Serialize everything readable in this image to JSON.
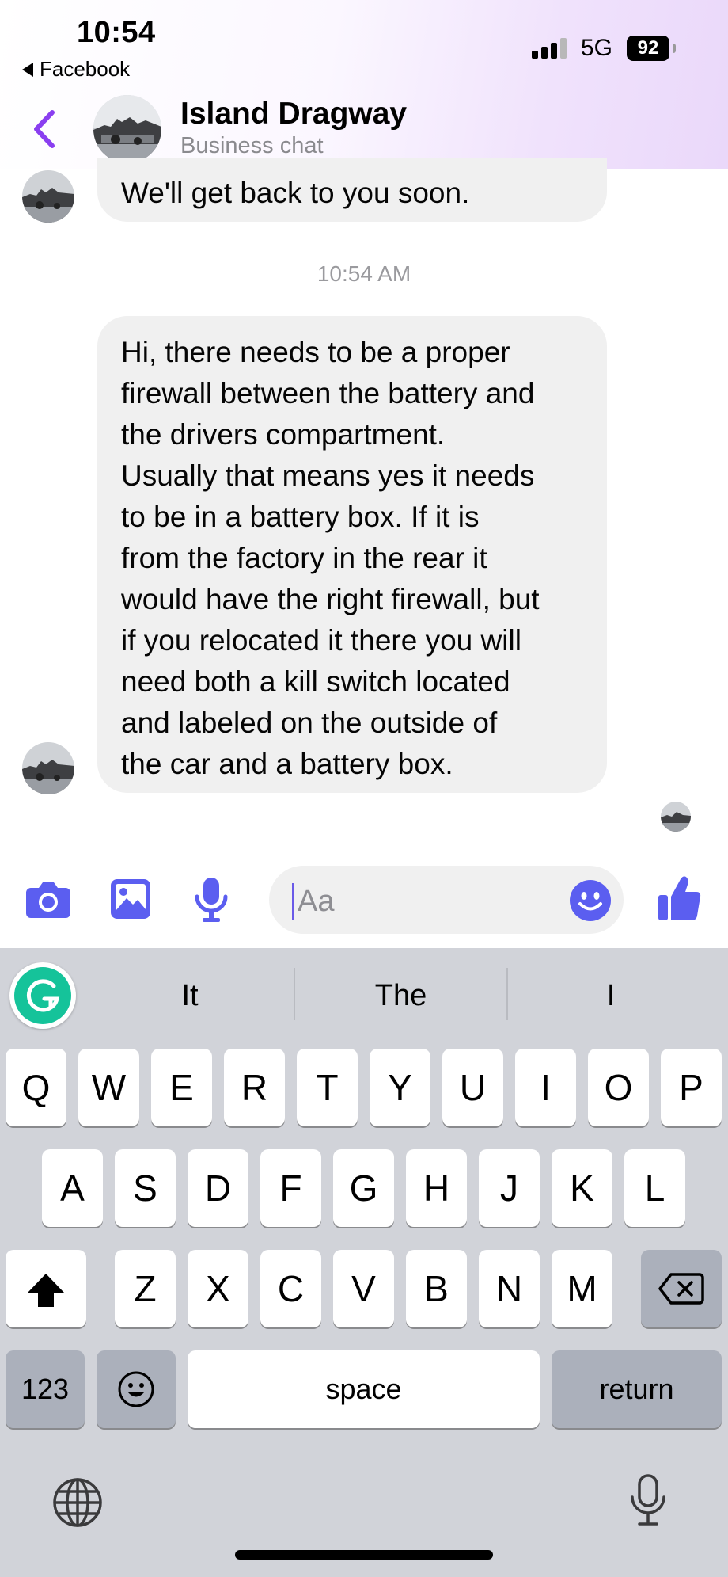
{
  "status_bar": {
    "time": "10:54",
    "back_app": "Facebook",
    "network": "5G",
    "battery": "92"
  },
  "header": {
    "contact_name": "Island Dragway",
    "contact_subtitle": "Business chat"
  },
  "messages": {
    "first_text": "We'll get back to you soon.",
    "timestamp": "10:54 AM",
    "second_lines": [
      "Hi, there needs to be a proper",
      "firewall between the battery and",
      "the drivers compartment.",
      "Usually that means yes it needs",
      "to be in a battery box. If it is",
      "from the factory in the rear it",
      "would have the right firewall, but",
      "if you relocated it there you will",
      "need both a kill switch located",
      "and labeled on the outside of",
      "the car and a battery box."
    ]
  },
  "composer": {
    "placeholder": "Aa",
    "accent_color": "#5b5ef0"
  },
  "keyboard": {
    "predictions": [
      "It",
      "The",
      "I"
    ],
    "row1": [
      "Q",
      "W",
      "E",
      "R",
      "T",
      "Y",
      "U",
      "I",
      "O",
      "P"
    ],
    "row2": [
      "A",
      "S",
      "D",
      "F",
      "G",
      "H",
      "J",
      "K",
      "L"
    ],
    "row3": [
      "Z",
      "X",
      "C",
      "V",
      "B",
      "N",
      "M"
    ],
    "numbers_key": "123",
    "space_key": "space",
    "return_key": "return"
  }
}
